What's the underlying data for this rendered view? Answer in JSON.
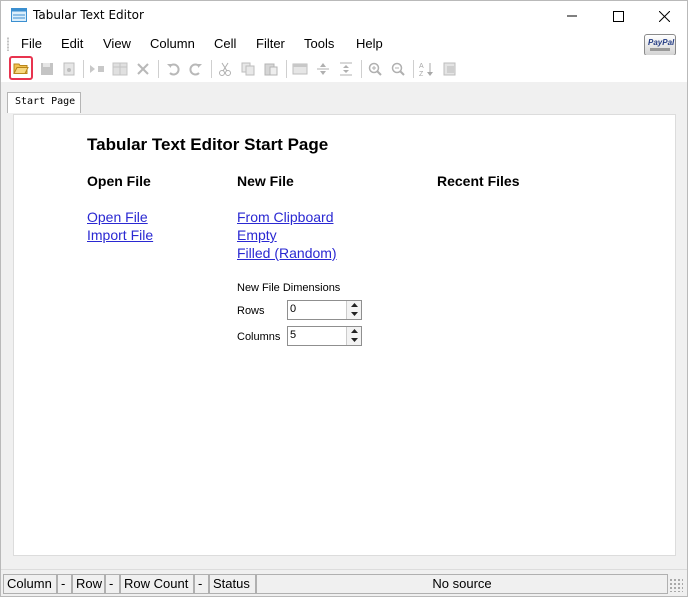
{
  "window": {
    "title": "Tabular Text Editor"
  },
  "menu": {
    "items": [
      "File",
      "Edit",
      "View",
      "Column",
      "Cell",
      "Filter",
      "Tools",
      "Help"
    ]
  },
  "paypal": {
    "label": "PayPal"
  },
  "tabs": [
    {
      "label": "Start Page"
    }
  ],
  "start_page": {
    "title": "Tabular Text Editor Start Page",
    "open_file": {
      "heading": "Open File",
      "links": [
        "Open File",
        "Import File"
      ]
    },
    "new_file": {
      "heading": "New File",
      "links": [
        "From Clipboard",
        "Empty",
        "Filled (Random)"
      ],
      "dimensions_label": "New File Dimensions",
      "rows_label": "Rows",
      "rows_value": "0",
      "columns_label": "Columns",
      "columns_value": "5"
    },
    "recent": {
      "heading": "Recent Files"
    }
  },
  "status": {
    "column_label": "Column",
    "column_value": "-",
    "row_label": "Row",
    "row_value": "-",
    "rowcount_label": "Row Count",
    "rowcount_value": "-",
    "status_label": "Status",
    "source": "No source"
  },
  "colors": {
    "link": "#2a28d2",
    "highlight": "#e8344f"
  }
}
